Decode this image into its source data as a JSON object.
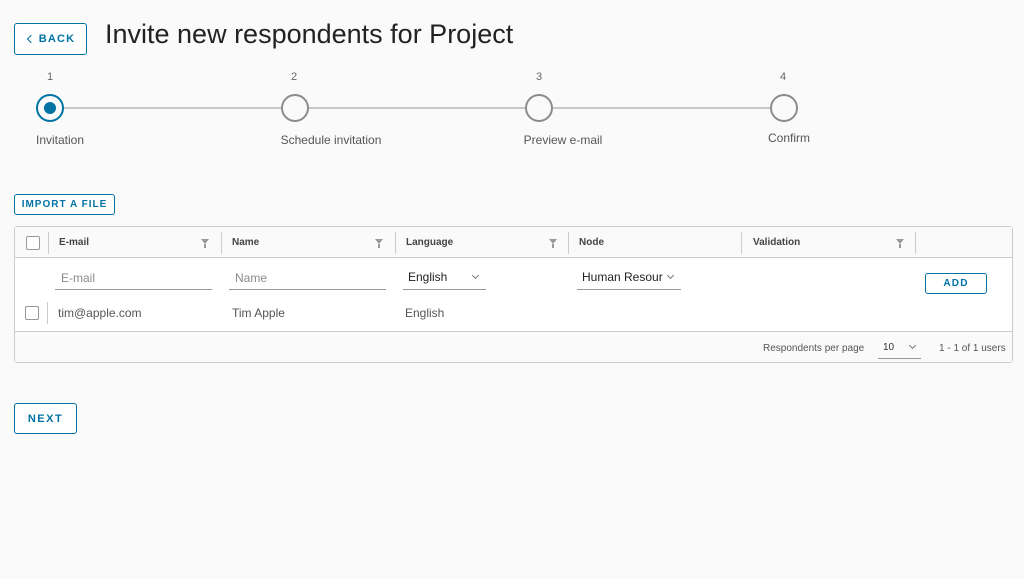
{
  "header": {
    "back_label": "BACK",
    "title": "Invite new respondents for Project"
  },
  "stepper": {
    "steps": [
      {
        "number": "1",
        "label": "Invitation",
        "active": true
      },
      {
        "number": "2",
        "label": "Schedule invitation",
        "active": false
      },
      {
        "number": "3",
        "label": "Preview e-mail",
        "active": false
      },
      {
        "number": "4",
        "label": "Confirm",
        "active": false
      }
    ]
  },
  "import_label": "IMPORT A FILE",
  "grid": {
    "columns": [
      "E-mail",
      "Name",
      "Language",
      "Node",
      "Validation"
    ],
    "new_row": {
      "email_placeholder": "E-mail",
      "name_placeholder": "Name",
      "language": "English",
      "node": "Human Resour",
      "add_label": "ADD"
    },
    "rows": [
      {
        "email": "tim@apple.com",
        "name": "Tim Apple",
        "language": "English"
      }
    ],
    "footer": {
      "per_page_label": "Respondents per page",
      "per_page_value": "10",
      "range": "1 - 1 of 1 users"
    }
  },
  "next_label": "NEXT",
  "colors": {
    "accent": "#0072a3",
    "border": "#cccccc",
    "background": "#fafafa"
  }
}
